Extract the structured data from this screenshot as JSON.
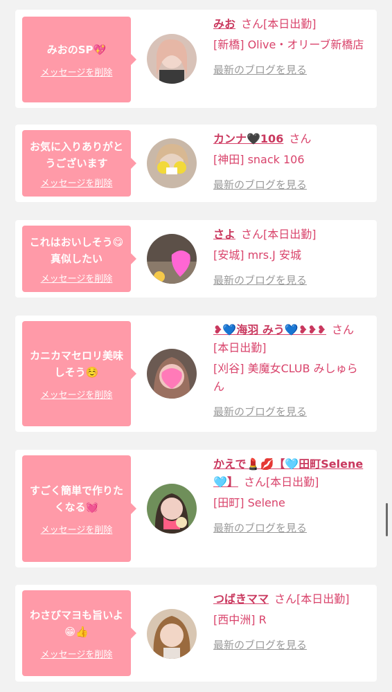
{
  "colors": {
    "bubble": "#ff9aa8",
    "name": "#d9436b",
    "blog": "#9a9a9a"
  },
  "cards": [
    {
      "message": "みおのSP💖",
      "delete": "メッセージを削除",
      "name": "みお",
      "suffix": "さん[本日出勤]",
      "shop": "[新橋] Olive・オリーブ新橋店",
      "blog": "最新のブログを見る"
    },
    {
      "message": "お気に入りありがとうございます",
      "delete": "メッセージを削除",
      "name": "カンナ🖤106",
      "suffix": "さん",
      "shop": "[神田] snack 106",
      "blog": "最新のブログを見る"
    },
    {
      "message": "これはおいしそう😋真似したい",
      "delete": "メッセージを削除",
      "name": "さよ",
      "suffix": "さん[本日出勤]",
      "shop": "[安城] mrs.J 安城",
      "blog": "最新のブログを見る"
    },
    {
      "message": "カニカマセロリ美味しそう☺️",
      "delete": "メッセージを削除",
      "name": "❥💙海羽 みう💙❥❥❥",
      "suffix": "さん[本日出勤]",
      "shop": "[刈谷] 美魔女CLUB みしゅらん",
      "blog": "最新のブログを見る"
    },
    {
      "message": "すごく簡単で作りたくなる💓",
      "delete": "メッセージを削除",
      "name": "かえで💄💋【🩵田町Selene🩵】",
      "suffix": "さん[本日出勤]",
      "shop": "[田町] Selene",
      "blog": "最新のブログを見る"
    },
    {
      "message": "わさびマヨも旨いよ😁👍",
      "delete": "メッセージを削除",
      "name": "つばきママ",
      "suffix": "さん[本日出勤]",
      "shop": "[西中洲] R",
      "blog": "最新のブログを見る"
    }
  ]
}
